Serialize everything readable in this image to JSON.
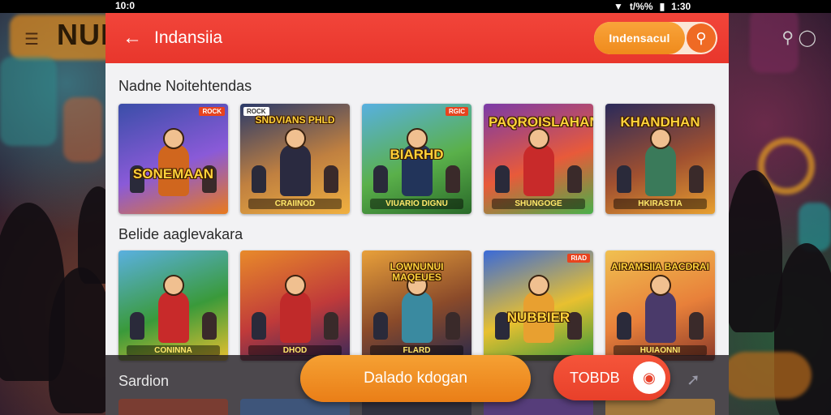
{
  "status_bar": {
    "left": "10:0",
    "wifi_icon": "wifi-icon",
    "signal_text": "t/%%",
    "battery_icon": "battery-icon",
    "time": "1:30"
  },
  "backdrop": {
    "left_banner_text": "NUI"
  },
  "header": {
    "title": "Indansiia",
    "search_button": "Indensacul",
    "back_icon": "back-arrow-icon",
    "search_icon": "search-icon"
  },
  "section1": {
    "title": "Nadne Noitehtendas",
    "items": [
      {
        "title": "SONEMAAN",
        "badge": "ROCK",
        "colors": [
          "#3a4ea8",
          "#8a5ad8",
          "#e87a1e"
        ],
        "hero": "#d0661e"
      },
      {
        "title": "SNDVIANS PHLD",
        "badge": "ROCK",
        "subtitle": "CRAIINOD",
        "colors": [
          "#2a3a6a",
          "#c08040",
          "#f0b040"
        ],
        "hero": "#2a2a40"
      },
      {
        "title": "BIARHD",
        "badge": "RGIC",
        "subtitle": "VIUARIO DIGNU",
        "colors": [
          "#58b0e0",
          "#5ab04a",
          "#2a6a2a"
        ],
        "hero": "#22345a"
      },
      {
        "title": "PAQROISLAHAN",
        "subtitle": "SHUNGOGE",
        "colors": [
          "#7a3aa8",
          "#e85a3a",
          "#4ab04a"
        ],
        "hero": "#c82a2a"
      },
      {
        "title": "KHANDHAN",
        "subtitle": "HKIRASTIA",
        "colors": [
          "#2a2a5a",
          "#a05030",
          "#e8a030"
        ],
        "hero": "#3a7a5a"
      }
    ]
  },
  "section2": {
    "title": "Belide aaglevakara",
    "items": [
      {
        "title": "",
        "subtitle": "CONINNA",
        "colors": [
          "#5ab0e0",
          "#3a9a3a",
          "#e8c030"
        ],
        "hero": "#c82a2a"
      },
      {
        "title": "",
        "subtitle": "DHOD",
        "colors": [
          "#e88a2a",
          "#c03a3a",
          "#3a2a5a"
        ],
        "hero": "#c02a2a"
      },
      {
        "title": "LOWNUNUI MAQEUES",
        "subtitle": "FLARD",
        "colors": [
          "#e8a03a",
          "#8a4a2a",
          "#2a2a4a"
        ],
        "hero": "#3a8aa0"
      },
      {
        "title": "NUBBIER",
        "badge": "RIAD",
        "colors": [
          "#3a6ad8",
          "#e8c030",
          "#3a9a3a"
        ],
        "hero": "#e8a030"
      },
      {
        "title": "AIRAMSIIA BACDRAI",
        "subtitle": "HUIAONNI",
        "colors": [
          "#f0c050",
          "#e8803a",
          "#8a3a2a"
        ],
        "hero": "#4a3a6a"
      }
    ]
  },
  "section3": {
    "title": "Sardion",
    "peek_colors": [
      "#8a3a2a",
      "#3a5a8a",
      "#2a2a3a",
      "#5a3a8a",
      "#c08a3a"
    ]
  },
  "actions": {
    "primary": "Dalado kdogan",
    "secondary": "TOBDB",
    "secondary_icon": "location-pin-icon",
    "chart_icon": "trend-chart-icon"
  }
}
